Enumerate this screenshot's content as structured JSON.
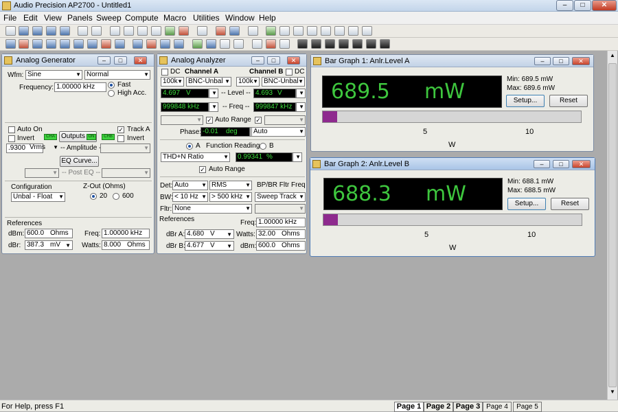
{
  "app": {
    "title": "Audio Precision AP2700 - Untitled1"
  },
  "menu": [
    "File",
    "Edit",
    "View",
    "Panels",
    "Sweep",
    "Compute",
    "Macro",
    "Utilities",
    "Window",
    "Help"
  ],
  "analog_generator": {
    "title": "Analog Generator",
    "wfm_label": "Wfm:",
    "wfm_value": "Sine",
    "wfm_mode": "Normal",
    "frequency_label": "Frequency:",
    "frequency_value": "1.00000 kHz",
    "fast": "Fast",
    "high_acc": "High Acc.",
    "auto_on": "Auto On",
    "track_a": "Track A",
    "invert_a": "Invert",
    "invert_b": "Invert",
    "outputs": "Outputs",
    "cha": "CHA",
    "chb": "CHB",
    "on": "ON",
    "amplitude_value": ".9300",
    "amplitude_unit": "Vrms",
    "amplitude_label": "-- Amplitude --",
    "eq_curve": "EQ Curve...",
    "post_eq": "-- Post EQ --",
    "configuration_label": "Configuration",
    "configuration_value": "Unbal - Float",
    "zout_label": "Z-Out (Ohms)",
    "zout_20": "20",
    "zout_600": "600",
    "references_label": "References",
    "dbm_label": "dBm:",
    "dbm_value": "600.0",
    "dbm_unit": "Ohms",
    "freq_label": "Freq:",
    "freq_value": "1.00000 kHz",
    "dbr_label": "dBr:",
    "dbr_value": "387.3",
    "dbr_unit": "mV",
    "watts_label": "Watts:",
    "watts_value": "8.000",
    "watts_unit": "Ohms"
  },
  "analog_analyzer": {
    "title": "Analog Analyzer",
    "dc_a": "DC",
    "dc_b": "DC",
    "channel_a": "Channel A",
    "channel_b": "Channel B",
    "range_a": "100k",
    "input_a": "BNC-Unbal",
    "range_b": "100k",
    "input_b": "BNC-Unbal",
    "level_label": "-- Level --",
    "level_a": "4.697",
    "level_a_unit": "V",
    "level_b": "4.693",
    "level_b_unit": "V",
    "freq_label": "-- Freq --",
    "freq_a": "999848 kHz",
    "freq_b": "999847 kHz",
    "auto_range": "Auto Range",
    "phase_label": "Phase:",
    "phase_value": "-0.01",
    "phase_unit": "deg",
    "phase_mode": "Auto",
    "radio_a": "A",
    "function_reading": "Function Reading",
    "radio_b": "B",
    "function_mode": "THD+N Ratio",
    "function_value": "0.99341",
    "function_unit": "%",
    "auto_range_2": "Auto Range",
    "det_label": "Det:",
    "det_value": "Auto",
    "det_mode": "RMS",
    "bp_label": "BP/BR Fltr Freq",
    "bw_label": "BW:",
    "bw_low": "< 10 Hz",
    "bw_high": "> 500 kHz",
    "bp_value": "Sweep Track",
    "fltr_label": "Fltr:",
    "fltr_value": "None",
    "references_label": "References",
    "ref_freq_label": "Freq:",
    "ref_freq_value": "1.00000 kHz",
    "dbra_label": "dBr A:",
    "dbra_value": "4.680",
    "dbra_unit": "V",
    "watts_label": "Watts:",
    "watts_value": "32.00",
    "watts_unit": "Ohms",
    "dbrb_label": "dBr B:",
    "dbrb_value": "4.677",
    "dbrb_unit": "V",
    "dbm_label": "dBm:",
    "dbm_value": "600.0",
    "dbm_unit": "Ohms"
  },
  "bar_graph_1": {
    "title": "Bar Graph 1: Anlr.Level A",
    "value": "689.5",
    "unit": "mW",
    "min": "Min: 689.5  mW",
    "max": "Max: 689.6  mW",
    "setup": "Setup...",
    "reset": "Reset",
    "level_fraction": 0.055,
    "ticks": [
      "5",
      "10"
    ],
    "axis_unit": "W"
  },
  "bar_graph_2": {
    "title": "Bar Graph 2: Anlr.Level B",
    "value": "688.3",
    "unit": "mW",
    "min": "Min: 688.1  mW",
    "max": "Max: 688.5  mW",
    "setup": "Setup...",
    "reset": "Reset",
    "level_fraction": 0.055,
    "ticks": [
      "5",
      "10"
    ],
    "axis_unit": "W"
  },
  "status": {
    "help": "For Help, press F1"
  },
  "pages": [
    "Page 1",
    "Page 2",
    "Page 3",
    "Page 4",
    "Page 5"
  ]
}
